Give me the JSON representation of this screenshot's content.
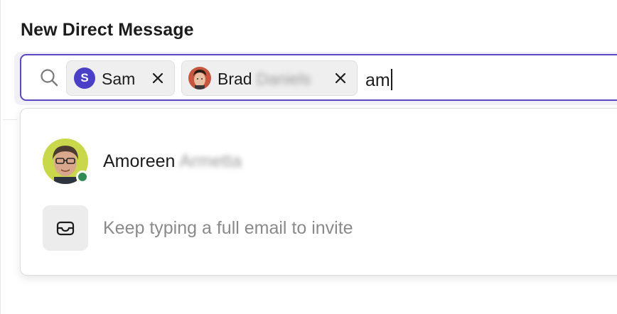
{
  "dialog": {
    "title": "New Direct Message"
  },
  "search": {
    "typed_value": "am",
    "recipients": [
      {
        "name": "Sam",
        "avatar_letter": "S",
        "avatar_color": "#4a3fc7"
      },
      {
        "name": "Brad",
        "surname_blurred": "Daniels"
      }
    ]
  },
  "results": {
    "user": {
      "first_name": "Amoreen",
      "last_name_blurred": "Armetta",
      "presence": "online",
      "presence_color": "#2f8a54"
    },
    "invite_hint": "Keep typing a full email to invite",
    "invite_icon": "envelope-icon"
  },
  "colors": {
    "focus_border": "#5a48c4",
    "chip_background": "#efefef"
  }
}
